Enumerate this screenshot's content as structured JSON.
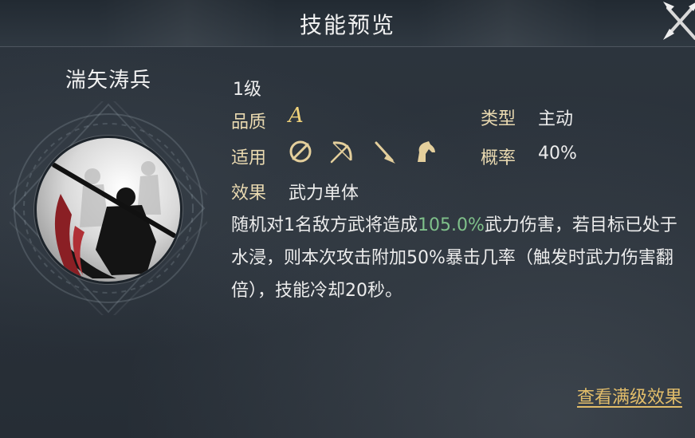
{
  "header": {
    "title": "技能预览"
  },
  "skill": {
    "name": "湍矢涛兵",
    "level": "1级",
    "quality_label": "品质",
    "quality_value": "A",
    "type_label": "类型",
    "type_value": "主动",
    "apply_label": "适用",
    "apply_icons": [
      "sword-disc-icon",
      "bow-icon",
      "spear-icon",
      "horse-icon"
    ],
    "rate_label": "概率",
    "rate_value": "40%",
    "effect_label": "效果",
    "effect_value": "武力单体",
    "description": {
      "part1": "随机对1名敌方武将造成",
      "highlight": "105.0%",
      "part2": "武力伤害，若目标已处于水浸，则本次攻击附加50%暴击几率（触发时武力伤害翻倍），技能冷却20秒。"
    }
  },
  "footer": {
    "full_level_link": "查看满级效果"
  },
  "colors": {
    "label": "#e9d9b0",
    "highlight": "#7fc08a",
    "link": "#e2bd6a",
    "quality": "#f0d27a"
  }
}
